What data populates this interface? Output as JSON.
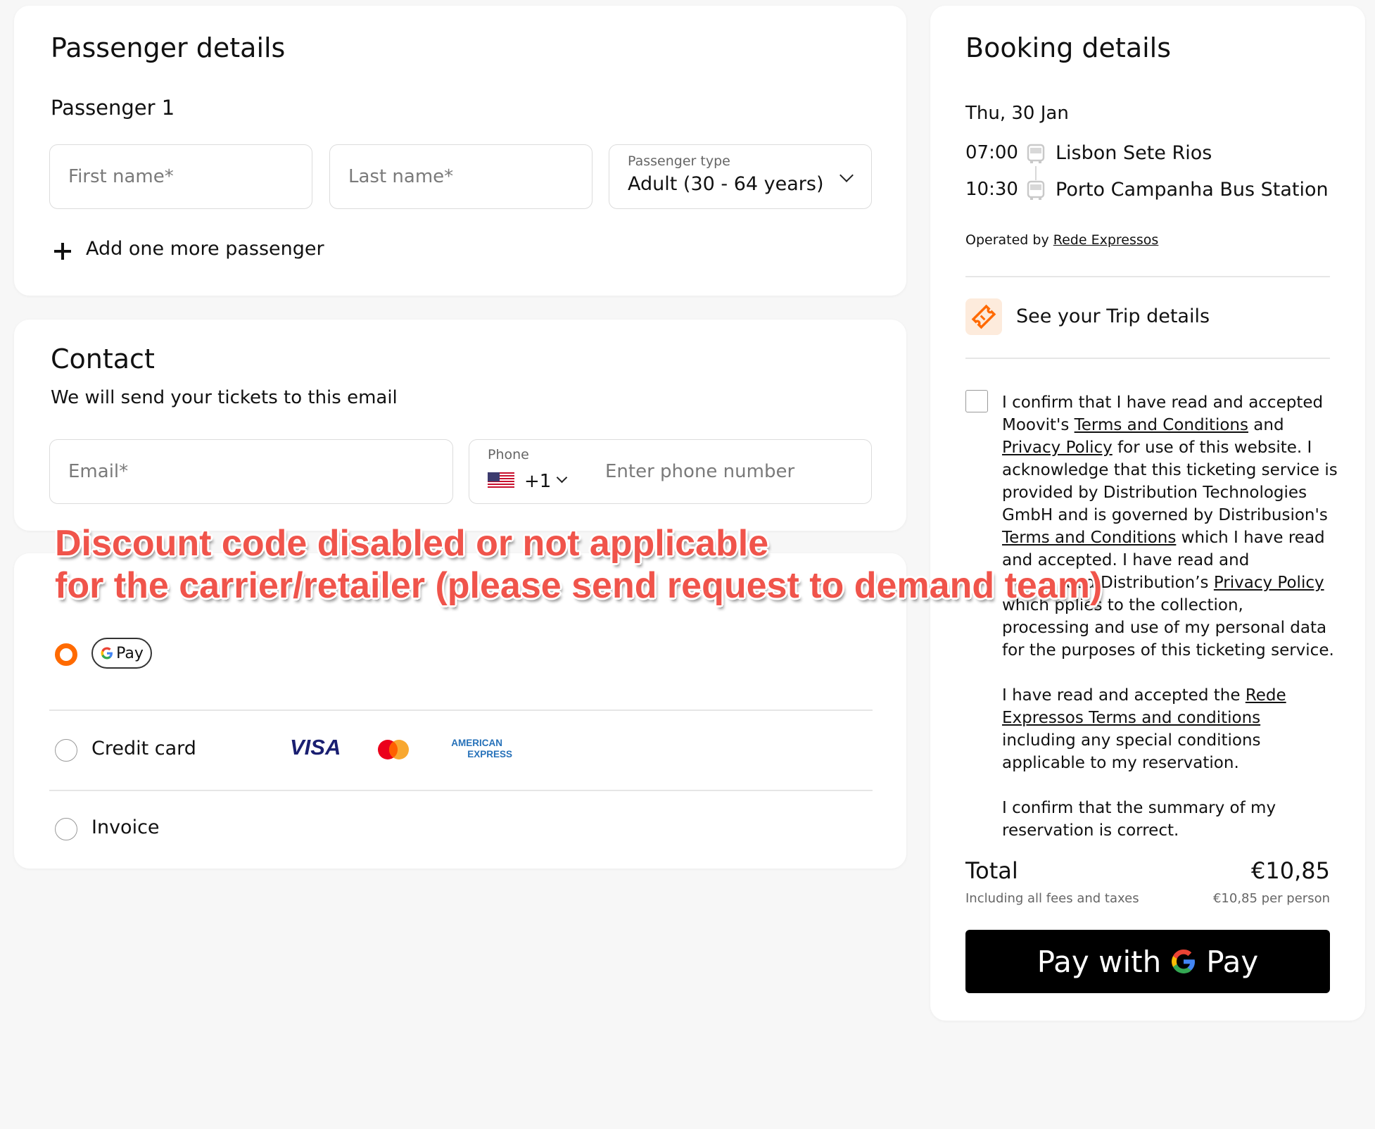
{
  "passenger": {
    "title": "Passenger details",
    "subtitle": "Passenger 1",
    "first_name_placeholder": "First name*",
    "last_name_placeholder": "Last name*",
    "type_label": "Passenger type",
    "type_value": "Adult (30 - 64 years)",
    "add_more": "Add one more passenger"
  },
  "contact": {
    "title": "Contact",
    "subtitle": "We will send your tickets to this email",
    "email_placeholder": "Email*",
    "phone_label": "Phone",
    "phone_code": "+1",
    "phone_placeholder": "Enter phone number"
  },
  "payment": {
    "gpay_chip": "Pay",
    "credit_card": "Credit card",
    "visa": "VISA",
    "amex_line1": "AMERICAN",
    "amex_line2": "EXPRESS",
    "invoice": "Invoice",
    "selected": "gpay"
  },
  "annotation": {
    "line1": "Discount code disabled or not applicable",
    "line2": "for the carrier/retailer (please send request to demand team)"
  },
  "booking": {
    "title": "Booking details",
    "date": "Thu, 30 Jan",
    "depart_time": "07:00",
    "depart_station": "Lisbon Sete Rios",
    "arrive_time": "10:30",
    "arrive_station": "Porto Campanha Bus Station",
    "operated_by": "Operated by",
    "operator": "Rede Expressos",
    "trip_details": "See your Trip details",
    "terms": {
      "t1": "I confirm that I have read and accepted",
      "t2a": "Moovit's ",
      "t2b": "Terms and Conditions",
      "t2c": " and",
      "t3a": "Privacy Policy",
      "t3b": " for use of this website. I",
      "t4": "acknowledge that this ticketing service is",
      "t5": "provided by Distribution Technologies",
      "t6": "GmbH and is governed by Distribusion's",
      "t7a": "Terms and Conditions",
      "t7b": " which I have read",
      "t8": "and accepted. I have read and",
      "t9a": "ood Distribution’s ",
      "t9b": "Privacy Policy",
      "t10a": "which ",
      "t10b": "pplies to the collection,",
      "t11": "processing and use of my personal data",
      "t12": "for the purposes of this ticketing service.",
      "p2a": "I have read and accepted the ",
      "p2b": "Rede",
      "p2c": "Expressos Terms and conditions",
      "p2d": "including any special conditions",
      "p2e": "applicable to my reservation.",
      "p3a": "I confirm that the summary of my",
      "p3b": "reservation is correct."
    },
    "total_label": "Total",
    "total_value": "€10,85",
    "fees_note": "Including all fees and taxes",
    "per_person": "€10,85 per person",
    "pay_button_prefix": "Pay with",
    "pay_button_suffix": "Pay"
  },
  "colors": {
    "accent": "#ff6a00",
    "annotation": "#f0544b",
    "visa": "#1a1f71",
    "amex": "#2671b9"
  }
}
